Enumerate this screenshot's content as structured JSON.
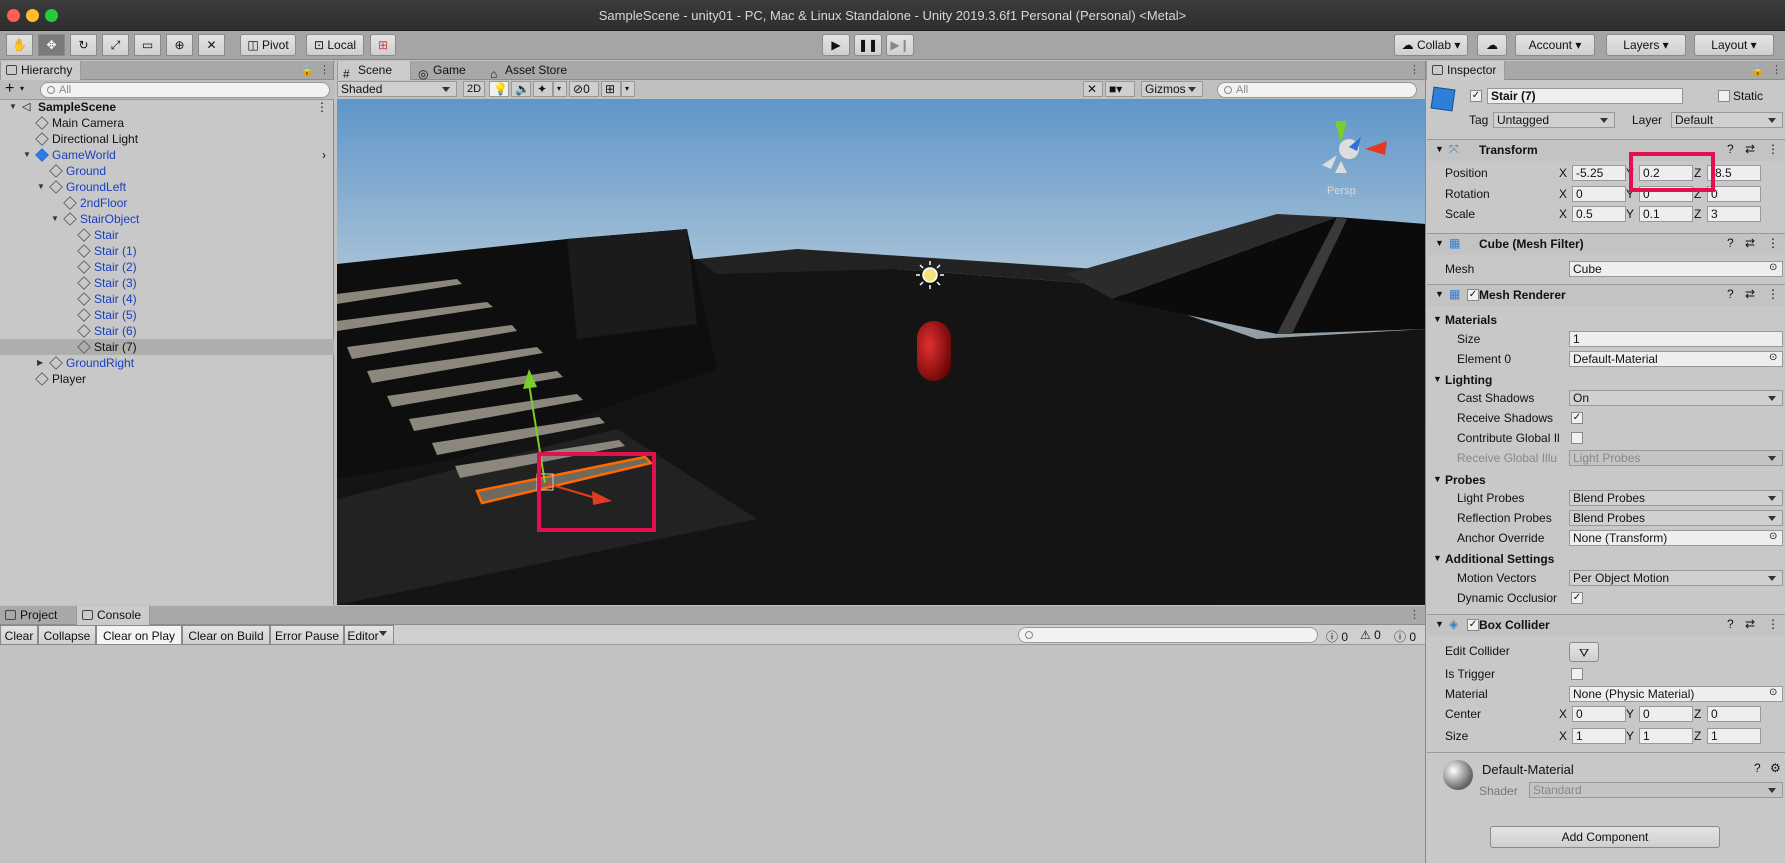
{
  "window": {
    "title": "SampleScene - unity01 - PC, Mac & Linux Standalone - Unity 2019.3.6f1 Personal (Personal) <Metal>"
  },
  "toolbar": {
    "pivot": "Pivot",
    "local": "Local",
    "collab": "Collab",
    "account": "Account",
    "layers": "Layers",
    "layout": "Layout"
  },
  "hierarchy": {
    "tab": "Hierarchy",
    "search": "All",
    "add": "+",
    "items": [
      "SampleScene",
      "Main Camera",
      "Directional Light",
      "GameWorld",
      "Ground",
      "GroundLeft",
      "2ndFloor",
      "StairObject",
      "Stair",
      "Stair (1)",
      "Stair (2)",
      "Stair (3)",
      "Stair (4)",
      "Stair (5)",
      "Stair (6)",
      "Stair (7)",
      "GroundRight",
      "Player"
    ]
  },
  "scene": {
    "tabs": [
      "Scene",
      "Game",
      "Asset Store"
    ],
    "shading": "Shaded",
    "mode2d": "2D",
    "hidden_count": "0",
    "gizmos": "Gizmos",
    "search": "All",
    "persp": "Persp"
  },
  "console": {
    "tabs": [
      "Project",
      "Console"
    ],
    "buttons": [
      "Clear",
      "Collapse",
      "Clear on Play",
      "Clear on Build",
      "Error Pause",
      "Editor"
    ],
    "counts": [
      "0",
      "0",
      "0"
    ]
  },
  "inspector": {
    "tab": "Inspector",
    "name": "Stair (7)",
    "static": "Static",
    "tag_label": "Tag",
    "tag": "Untagged",
    "layer_label": "Layer",
    "layer": "Default",
    "transform": {
      "title": "Transform",
      "position_label": "Position",
      "rotation_label": "Rotation",
      "scale_label": "Scale",
      "px": "-5.25",
      "py": "0.2",
      "pz": "-8.5",
      "rx": "0",
      "ry": "0",
      "rz": "0",
      "sx": "0.5",
      "sy": "0.1",
      "sz": "3"
    },
    "meshfilter": {
      "title": "Cube (Mesh Filter)",
      "mesh_label": "Mesh",
      "mesh": "Cube"
    },
    "meshrenderer": {
      "title": "Mesh Renderer",
      "materials": "Materials",
      "size_label": "Size",
      "size": "1",
      "element0_label": "Element 0",
      "element0": "Default-Material",
      "lighting": "Lighting",
      "cast_label": "Cast Shadows",
      "cast": "On",
      "receive_label": "Receive Shadows",
      "contribute_label": "Contribute Global Il",
      "receive_gi_label": "Receive Global Illu",
      "receive_gi": "Light Probes",
      "probes": "Probes",
      "light_probes_label": "Light Probes",
      "light_probes": "Blend Probes",
      "refl_label": "Reflection Probes",
      "refl": "Blend Probes",
      "anchor_label": "Anchor Override",
      "anchor": "None (Transform)",
      "additional": "Additional Settings",
      "motion_label": "Motion Vectors",
      "motion": "Per Object Motion",
      "dyn_label": "Dynamic Occlusior"
    },
    "boxcollider": {
      "title": "Box Collider",
      "edit_label": "Edit Collider",
      "trigger_label": "Is Trigger",
      "material_label": "Material",
      "material": "None (Physic Material)",
      "center_label": "Center",
      "cx": "0",
      "cy": "0",
      "cz": "0",
      "size_label": "Size",
      "sx": "1",
      "sy": "1",
      "sz": "1"
    },
    "material": {
      "name": "Default-Material",
      "shader_label": "Shader",
      "shader": "Standard"
    },
    "add_component": "Add Component"
  },
  "axis": {
    "x": "X",
    "y": "Y",
    "z": "Z"
  },
  "colors": {
    "highlight": "#e0114f",
    "selection_orange": "#ff6a00"
  }
}
